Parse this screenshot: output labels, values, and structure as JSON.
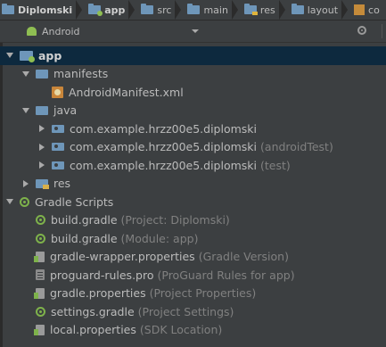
{
  "breadcrumb": [
    "Diplomski",
    "app",
    "src",
    "main",
    "res",
    "layout",
    "co"
  ],
  "panel": {
    "view_mode": "Android"
  },
  "tree": [
    {
      "indent": 0,
      "arrow": "down",
      "icon": "app-folder-icon",
      "label": "app",
      "bold": true,
      "hint": "",
      "selected": true
    },
    {
      "indent": 1,
      "arrow": "down",
      "icon": "folder-icon",
      "label": "manifests",
      "bold": false,
      "hint": "",
      "selected": false
    },
    {
      "indent": 2,
      "arrow": "none",
      "icon": "manifest-file-icon",
      "label": "AndroidManifest.xml",
      "bold": false,
      "hint": "",
      "selected": false
    },
    {
      "indent": 1,
      "arrow": "down",
      "icon": "folder-icon",
      "label": "java",
      "bold": false,
      "hint": "",
      "selected": false
    },
    {
      "indent": 2,
      "arrow": "right",
      "icon": "package-icon",
      "label": "com.example.hrzz00e5.diplomski",
      "bold": false,
      "hint": "",
      "selected": false
    },
    {
      "indent": 2,
      "arrow": "right",
      "icon": "package-icon",
      "label": "com.example.hrzz00e5.diplomski",
      "bold": false,
      "hint": "(androidTest)",
      "selected": false
    },
    {
      "indent": 2,
      "arrow": "right",
      "icon": "package-icon",
      "label": "com.example.hrzz00e5.diplomski",
      "bold": false,
      "hint": "(test)",
      "selected": false
    },
    {
      "indent": 1,
      "arrow": "right",
      "icon": "res-folder-icon",
      "label": "res",
      "bold": false,
      "hint": "",
      "selected": false
    },
    {
      "indent": 0,
      "arrow": "down",
      "icon": "gradle-icon",
      "label": "Gradle Scripts",
      "bold": false,
      "hint": "",
      "selected": false
    },
    {
      "indent": 1,
      "arrow": "none",
      "icon": "gradle-icon",
      "label": "build.gradle",
      "bold": false,
      "hint": "(Project: Diplomski)",
      "selected": false
    },
    {
      "indent": 1,
      "arrow": "none",
      "icon": "gradle-icon",
      "label": "build.gradle",
      "bold": false,
      "hint": "(Module: app)",
      "selected": false
    },
    {
      "indent": 1,
      "arrow": "none",
      "icon": "properties-icon",
      "label": "gradle-wrapper.properties",
      "bold": false,
      "hint": "(Gradle Version)",
      "selected": false
    },
    {
      "indent": 1,
      "arrow": "none",
      "icon": "proguard-file-icon",
      "label": "proguard-rules.pro",
      "bold": false,
      "hint": "(ProGuard Rules for app)",
      "selected": false
    },
    {
      "indent": 1,
      "arrow": "none",
      "icon": "properties-icon",
      "label": "gradle.properties",
      "bold": false,
      "hint": "(Project Properties)",
      "selected": false
    },
    {
      "indent": 1,
      "arrow": "none",
      "icon": "gradle-icon",
      "label": "settings.gradle",
      "bold": false,
      "hint": "(Project Settings)",
      "selected": false
    },
    {
      "indent": 1,
      "arrow": "none",
      "icon": "properties-icon",
      "label": "local.properties",
      "bold": false,
      "hint": "(SDK Location)",
      "selected": false
    }
  ]
}
